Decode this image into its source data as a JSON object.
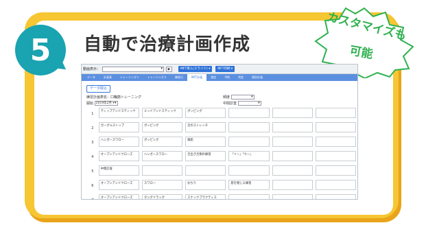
{
  "step_number": "5",
  "title": "自動で治療計画作成",
  "badge": {
    "line1": "カスタマイズも",
    "line2": "可能"
  },
  "colors": {
    "frame": "#f6c633",
    "badge_circle": "#1aa3b0",
    "badge_green": "#2fb14f",
    "app_accent": "#2f73d8"
  },
  "app": {
    "toolbar": {
      "label": "動画表示：",
      "play": "▶",
      "btn_import": "MFT導入(スライド) ▾",
      "btn_print": "MFT印刷 ▾"
    },
    "tabs": [
      "データ",
      "計画表",
      "トレーニング１",
      "トレーニング２",
      "練習日",
      "MFT計画",
      "測定",
      "予約",
      "判定",
      "個別計画"
    ],
    "active_tab_index": 5,
    "import_button": "データ取込",
    "plan_label": "練習計画表名：口輪筋トレーニング",
    "start_label": "開始",
    "start_value": "2019年2月 ▾",
    "freq_label": "頻度",
    "mid_label": "中間診査",
    "grid": [
      {
        "row": "1",
        "cells": [
          "ティップアンドスティック",
          "ミッドアンドスティック",
          "ポッピング",
          "",
          "",
          ""
        ]
      },
      {
        "row": "2",
        "cells": [
          "ガーグルストップ",
          "ポッピング",
          "舌のストレッチ",
          "",
          "",
          ""
        ]
      },
      {
        "row": "3",
        "cells": [
          "ハンガースワロー",
          "ポッピング",
          "風船",
          "",
          "",
          ""
        ]
      },
      {
        "row": "4",
        "cells": [
          "オープンアンドクローズ",
          "ハンガースワロー",
          "舌出き舌側の練習",
          "「イー」「ウー」",
          "",
          ""
        ]
      },
      {
        "row": "5",
        "cells": [
          "中間診査",
          "",
          "",
          "",
          "",
          ""
        ]
      },
      {
        "row": "6",
        "cells": [
          "オープンアンドクローズ",
          "スワロー",
          "おちり",
          "唇を閉じる練習",
          "",
          ""
        ]
      },
      {
        "row": "7",
        "cells": [
          "オープンアンドクローズ",
          "タングドラッグ",
          "スナックプラクティス",
          "",
          "",
          ""
        ]
      }
    ]
  }
}
